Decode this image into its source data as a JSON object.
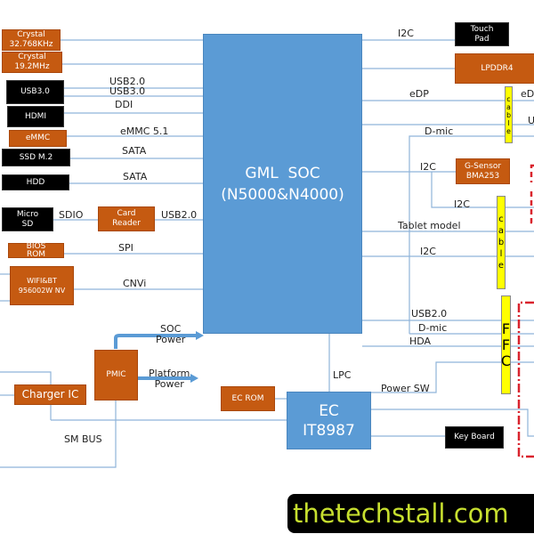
{
  "colors": {
    "soc": "#5b9bd5",
    "component": "#c55a11",
    "external": "#000000",
    "cable": "#ffff00",
    "wire": "#8fb4d9",
    "boundary": "#d9232d",
    "watermark": "#c7df2f"
  },
  "soc": {
    "name": "GML  SOC",
    "models": "(N5000&N4000)"
  },
  "ec": {
    "name": "EC",
    "model": "IT8987"
  },
  "left_blocks": {
    "crystal1": [
      "Crystal",
      "32.768KHz"
    ],
    "crystal2": [
      "Crystal",
      "19.2MHz"
    ],
    "usb3": "USB3.0",
    "hdmi": "HDMI",
    "emmc": "eMMC",
    "ssd": "SSD  M.2",
    "hdd": "HDD",
    "microsd": [
      "Micro",
      "SD"
    ],
    "card_reader": [
      "Card",
      "Reader"
    ],
    "bios": [
      "BIOS",
      "ROM"
    ],
    "wifi": [
      "WIFI&BT",
      "956002W NV"
    ],
    "pmic": "PMIC",
    "charger": "Charger IC",
    "ec_rom": "EC ROM"
  },
  "left_labels": {
    "usb20": "USB2.0",
    "usb30": "USB3.0",
    "ddi": "DDI",
    "emmc": "eMMC 5.1",
    "sata1": "SATA",
    "sata2": "SATA",
    "sdio": "SDIO",
    "usb20b": "USB2.0",
    "spi": "SPI",
    "cnvi": "CNVi",
    "soc_power": [
      "SOC",
      "Power"
    ],
    "platform_power": [
      "Platform",
      "Power"
    ],
    "smbus": "SM BUS",
    "lpc": "LPC",
    "power_sw": "Power SW"
  },
  "right_blocks": {
    "touchpad": [
      "Touch",
      "Pad"
    ],
    "lpddr4": "LPDDR4",
    "gsensor": [
      "G-Sensor",
      "BMA253"
    ],
    "keyboard": "Key Board"
  },
  "right_labels": {
    "i2c1": "I2C",
    "edp": "eDP",
    "edp_out": "eD",
    "u_out": "U",
    "dmic1": "D-mic",
    "i2c2": "I2C",
    "i2c3": "I2C",
    "tablet": "Tablet model",
    "i2c4": "I2C",
    "usb20": "USB2.0",
    "dmic2": "D-mic",
    "hda": "HDA"
  },
  "cables": {
    "cable1": [
      "c",
      "a",
      "b",
      "l",
      "e"
    ],
    "cable2": [
      "c",
      "a",
      "b",
      "l",
      "e"
    ],
    "ffc": [
      "F",
      "F",
      "C"
    ]
  },
  "watermark": "thetechstall.com"
}
